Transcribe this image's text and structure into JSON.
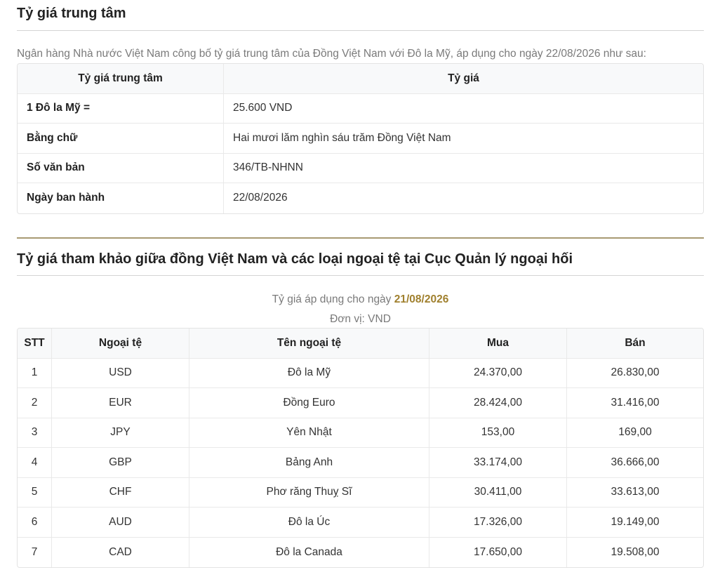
{
  "central_rate": {
    "title": "Tỷ giá trung tâm",
    "intro": "Ngân hàng Nhà nước Việt Nam công bố tỷ giá trung tâm của Đồng Việt Nam với Đô la Mỹ, áp dụng cho ngày 22/08/2026 như sau:",
    "headers": [
      "Tỷ giá trung tâm",
      "Tỷ giá"
    ],
    "rows": [
      {
        "label": "1 Đô la Mỹ =",
        "value": "25.600 VND"
      },
      {
        "label": "Bằng chữ",
        "value": "Hai mươi lăm nghìn sáu trăm Đồng Việt Nam"
      },
      {
        "label": "Số văn bản",
        "value": "346/TB-NHNN"
      },
      {
        "label": "Ngày ban hành",
        "value": "22/08/2026"
      }
    ]
  },
  "reference_rates": {
    "title": "Tỷ giá tham khảo giữa đồng Việt Nam và các loại ngoại tệ tại Cục Quản lý ngoại hối",
    "applied_prefix": "Tỷ giá áp dụng cho ngày ",
    "applied_date": "21/08/2026",
    "unit": "Đơn vị: VND",
    "headers": [
      "STT",
      "Ngoại tệ",
      "Tên ngoại tệ",
      "Mua",
      "Bán"
    ],
    "rows": [
      {
        "stt": "1",
        "code": "USD",
        "name": "Đô la Mỹ",
        "buy": "24.370,00",
        "sell": "26.830,00"
      },
      {
        "stt": "2",
        "code": "EUR",
        "name": "Đồng Euro",
        "buy": "28.424,00",
        "sell": "31.416,00"
      },
      {
        "stt": "3",
        "code": "JPY",
        "name": "Yên Nhật",
        "buy": "153,00",
        "sell": "169,00"
      },
      {
        "stt": "4",
        "code": "GBP",
        "name": "Bảng Anh",
        "buy": "33.174,00",
        "sell": "36.666,00"
      },
      {
        "stt": "5",
        "code": "CHF",
        "name": "Phơ răng Thuỵ Sĩ",
        "buy": "30.411,00",
        "sell": "33.613,00"
      },
      {
        "stt": "6",
        "code": "AUD",
        "name": "Đô la Úc",
        "buy": "17.326,00",
        "sell": "19.149,00"
      },
      {
        "stt": "7",
        "code": "CAD",
        "name": "Đô la Canada",
        "buy": "17.650,00",
        "sell": "19.508,00"
      }
    ]
  },
  "colors": {
    "accent_gold": "#a0802e",
    "divider_gold": "#a89a72",
    "header_bg": "#f8f9fa"
  }
}
